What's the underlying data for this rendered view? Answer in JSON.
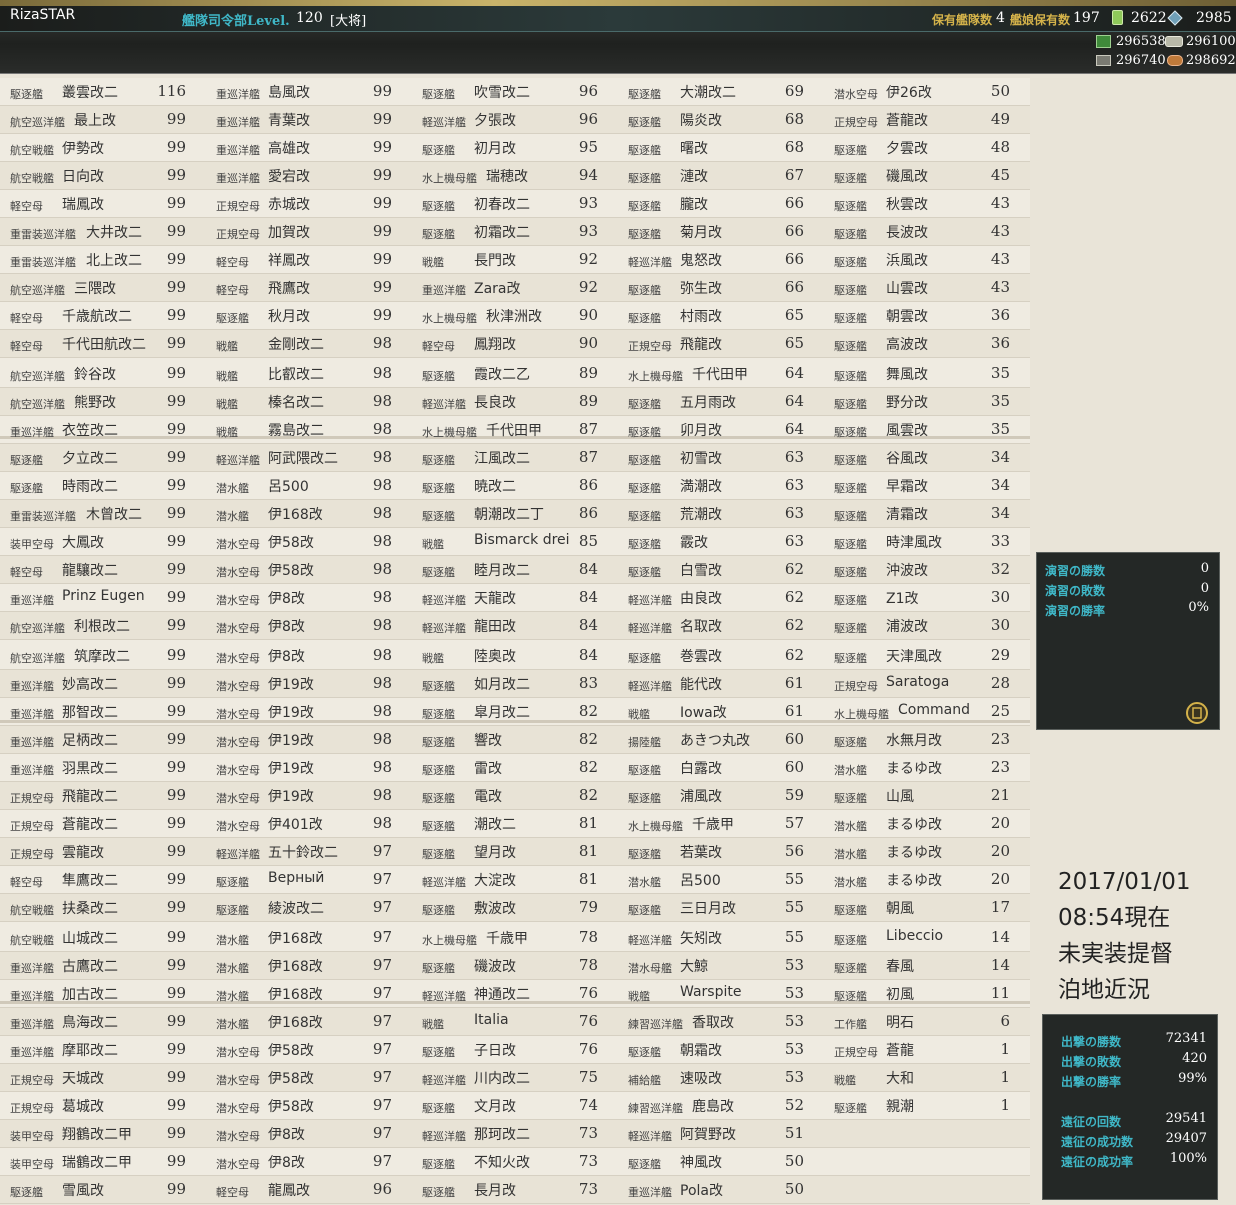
{
  "app": {
    "title": "RizaSTAR"
  },
  "header": {
    "hq_label": "艦隊司令部Level.",
    "hq_level": "120",
    "hq_rank": "[大将]",
    "fleet_label": "保有艦隊数",
    "fleet_count": "4",
    "ship_label": "艦娘保有数",
    "ship_count": "197",
    "bucket": "2622",
    "devmat": "2985",
    "fuel": "296538",
    "ammo": "296100",
    "steel": "296740",
    "bauxite": "298692"
  },
  "ships": [
    [
      "駆逐艦",
      "叢雲改二",
      "116",
      "重巡洋艦",
      "島風改",
      "99",
      "駆逐艦",
      "吹雪改二",
      "96",
      "駆逐艦",
      "大潮改二",
      "69",
      "潜水空母",
      "伊26改",
      "50"
    ],
    [
      "航空巡洋艦",
      "最上改",
      "99",
      "重巡洋艦",
      "青葉改",
      "99",
      "軽巡洋艦",
      "夕張改",
      "96",
      "駆逐艦",
      "陽炎改",
      "68",
      "正規空母",
      "蒼龍改",
      "49"
    ],
    [
      "航空戦艦",
      "伊勢改",
      "99",
      "重巡洋艦",
      "高雄改",
      "99",
      "駆逐艦",
      "初月改",
      "95",
      "駆逐艦",
      "曙改",
      "68",
      "駆逐艦",
      "夕雲改",
      "48"
    ],
    [
      "航空戦艦",
      "日向改",
      "99",
      "重巡洋艦",
      "愛宕改",
      "99",
      "水上機母艦",
      "瑞穂改",
      "94",
      "駆逐艦",
      "漣改",
      "67",
      "駆逐艦",
      "磯風改",
      "45"
    ],
    [
      "軽空母",
      "瑞鳳改",
      "99",
      "正規空母",
      "赤城改",
      "99",
      "駆逐艦",
      "初春改二",
      "93",
      "駆逐艦",
      "朧改",
      "66",
      "駆逐艦",
      "秋雲改",
      "43"
    ],
    [
      "重雷装巡洋艦",
      "大井改二",
      "99",
      "正規空母",
      "加賀改",
      "99",
      "駆逐艦",
      "初霜改二",
      "93",
      "駆逐艦",
      "菊月改",
      "66",
      "駆逐艦",
      "長波改",
      "43"
    ],
    [
      "重雷装巡洋艦",
      "北上改二",
      "99",
      "軽空母",
      "祥鳳改",
      "99",
      "戦艦",
      "長門改",
      "92",
      "軽巡洋艦",
      "鬼怒改",
      "66",
      "駆逐艦",
      "浜風改",
      "43"
    ],
    [
      "航空巡洋艦",
      "三隈改",
      "99",
      "軽空母",
      "飛鷹改",
      "99",
      "重巡洋艦",
      "Zara改",
      "92",
      "駆逐艦",
      "弥生改",
      "66",
      "駆逐艦",
      "山雲改",
      "43"
    ],
    [
      "軽空母",
      "千歳航改二",
      "99",
      "駆逐艦",
      "秋月改",
      "99",
      "水上機母艦",
      "秋津洲改",
      "90",
      "駆逐艦",
      "村雨改",
      "65",
      "駆逐艦",
      "朝雲改",
      "36"
    ],
    [
      "軽空母",
      "千代田航改二",
      "99",
      "戦艦",
      "金剛改二",
      "98",
      "軽空母",
      "鳳翔改",
      "90",
      "正規空母",
      "飛龍改",
      "65",
      "駆逐艦",
      "高波改",
      "36"
    ],
    [
      "航空巡洋艦",
      "鈴谷改",
      "99",
      "戦艦",
      "比叡改二",
      "98",
      "駆逐艦",
      "霞改二乙",
      "89",
      "水上機母艦",
      "千代田甲",
      "64",
      "駆逐艦",
      "舞風改",
      "35"
    ],
    [
      "航空巡洋艦",
      "熊野改",
      "99",
      "戦艦",
      "榛名改二",
      "98",
      "軽巡洋艦",
      "長良改",
      "89",
      "駆逐艦",
      "五月雨改",
      "64",
      "駆逐艦",
      "野分改",
      "35"
    ],
    [
      "重巡洋艦",
      "衣笠改二",
      "99",
      "戦艦",
      "霧島改二",
      "98",
      "水上機母艦",
      "千代田甲",
      "87",
      "駆逐艦",
      "卯月改",
      "64",
      "駆逐艦",
      "風雲改",
      "35"
    ],
    [
      "駆逐艦",
      "夕立改二",
      "99",
      "軽巡洋艦",
      "阿武隈改二",
      "98",
      "駆逐艦",
      "江風改二",
      "87",
      "駆逐艦",
      "初雪改",
      "63",
      "駆逐艦",
      "谷風改",
      "34"
    ],
    [
      "駆逐艦",
      "時雨改二",
      "99",
      "潜水艦",
      "呂500",
      "98",
      "駆逐艦",
      "暁改二",
      "86",
      "駆逐艦",
      "満潮改",
      "63",
      "駆逐艦",
      "早霜改",
      "34"
    ],
    [
      "重雷装巡洋艦",
      "木曾改二",
      "99",
      "潜水艦",
      "伊168改",
      "98",
      "駆逐艦",
      "朝潮改二丁",
      "86",
      "駆逐艦",
      "荒潮改",
      "63",
      "駆逐艦",
      "清霜改",
      "34"
    ],
    [
      "装甲空母",
      "大鳳改",
      "99",
      "潜水空母",
      "伊58改",
      "98",
      "戦艦",
      "Bismarck drei",
      "85",
      "駆逐艦",
      "霰改",
      "63",
      "駆逐艦",
      "時津風改",
      "33"
    ],
    [
      "軽空母",
      "龍驤改二",
      "99",
      "潜水空母",
      "伊58改",
      "98",
      "駆逐艦",
      "睦月改二",
      "84",
      "駆逐艦",
      "白雪改",
      "62",
      "駆逐艦",
      "沖波改",
      "32"
    ],
    [
      "重巡洋艦",
      "Prinz Eugen",
      "99",
      "潜水空母",
      "伊8改",
      "98",
      "軽巡洋艦",
      "天龍改",
      "84",
      "軽巡洋艦",
      "由良改",
      "62",
      "駆逐艦",
      "Z1改",
      "30"
    ],
    [
      "航空巡洋艦",
      "利根改二",
      "99",
      "潜水空母",
      "伊8改",
      "98",
      "軽巡洋艦",
      "龍田改",
      "84",
      "軽巡洋艦",
      "名取改",
      "62",
      "駆逐艦",
      "浦波改",
      "30"
    ],
    [
      "航空巡洋艦",
      "筑摩改二",
      "99",
      "潜水空母",
      "伊8改",
      "98",
      "戦艦",
      "陸奥改",
      "84",
      "駆逐艦",
      "巻雲改",
      "62",
      "駆逐艦",
      "天津風改",
      "29"
    ],
    [
      "重巡洋艦",
      "妙高改二",
      "99",
      "潜水空母",
      "伊19改",
      "98",
      "駆逐艦",
      "如月改二",
      "83",
      "軽巡洋艦",
      "能代改",
      "61",
      "正規空母",
      "Saratoga",
      "28"
    ],
    [
      "重巡洋艦",
      "那智改二",
      "99",
      "潜水空母",
      "伊19改",
      "98",
      "駆逐艦",
      "皐月改二",
      "82",
      "戦艦",
      "Iowa改",
      "61",
      "水上機母艦",
      "Command",
      "25"
    ],
    [
      "重巡洋艦",
      "足柄改二",
      "99",
      "潜水空母",
      "伊19改",
      "98",
      "駆逐艦",
      "響改",
      "82",
      "揚陸艦",
      "あきつ丸改",
      "60",
      "駆逐艦",
      "水無月改",
      "23"
    ],
    [
      "重巡洋艦",
      "羽黒改二",
      "99",
      "潜水空母",
      "伊19改",
      "98",
      "駆逐艦",
      "雷改",
      "82",
      "駆逐艦",
      "白露改",
      "60",
      "潜水艦",
      "まるゆ改",
      "23"
    ],
    [
      "正規空母",
      "飛龍改二",
      "99",
      "潜水空母",
      "伊19改",
      "98",
      "駆逐艦",
      "電改",
      "82",
      "駆逐艦",
      "浦風改",
      "59",
      "駆逐艦",
      "山風",
      "21"
    ],
    [
      "正規空母",
      "蒼龍改二",
      "99",
      "潜水空母",
      "伊401改",
      "98",
      "駆逐艦",
      "潮改二",
      "81",
      "水上機母艦",
      "千歳甲",
      "57",
      "潜水艦",
      "まるゆ改",
      "20"
    ],
    [
      "正規空母",
      "雲龍改",
      "99",
      "軽巡洋艦",
      "五十鈴改二",
      "97",
      "駆逐艦",
      "望月改",
      "81",
      "駆逐艦",
      "若葉改",
      "56",
      "潜水艦",
      "まるゆ改",
      "20"
    ],
    [
      "軽空母",
      "隼鷹改二",
      "99",
      "駆逐艦",
      "Верный",
      "97",
      "軽巡洋艦",
      "大淀改",
      "81",
      "潜水艦",
      "呂500",
      "55",
      "潜水艦",
      "まるゆ改",
      "20"
    ],
    [
      "航空戦艦",
      "扶桑改二",
      "99",
      "駆逐艦",
      "綾波改二",
      "97",
      "駆逐艦",
      "敷波改",
      "79",
      "駆逐艦",
      "三日月改",
      "55",
      "駆逐艦",
      "朝風",
      "17"
    ],
    [
      "航空戦艦",
      "山城改二",
      "99",
      "潜水艦",
      "伊168改",
      "97",
      "水上機母艦",
      "千歳甲",
      "78",
      "軽巡洋艦",
      "矢矧改",
      "55",
      "駆逐艦",
      "Libeccio",
      "14"
    ],
    [
      "重巡洋艦",
      "古鷹改二",
      "99",
      "潜水艦",
      "伊168改",
      "97",
      "駆逐艦",
      "磯波改",
      "78",
      "潜水母艦",
      "大鯨",
      "53",
      "駆逐艦",
      "春風",
      "14"
    ],
    [
      "重巡洋艦",
      "加古改二",
      "99",
      "潜水艦",
      "伊168改",
      "97",
      "軽巡洋艦",
      "神通改二",
      "76",
      "戦艦",
      "Warspite",
      "53",
      "駆逐艦",
      "初風",
      "11"
    ],
    [
      "重巡洋艦",
      "鳥海改二",
      "99",
      "潜水艦",
      "伊168改",
      "97",
      "戦艦",
      "Italia",
      "76",
      "練習巡洋艦",
      "香取改",
      "53",
      "工作艦",
      "明石",
      "6"
    ],
    [
      "重巡洋艦",
      "摩耶改二",
      "99",
      "潜水空母",
      "伊58改",
      "97",
      "駆逐艦",
      "子日改",
      "76",
      "駆逐艦",
      "朝霜改",
      "53",
      "正規空母",
      "蒼龍",
      "1"
    ],
    [
      "正規空母",
      "天城改",
      "99",
      "潜水空母",
      "伊58改",
      "97",
      "軽巡洋艦",
      "川内改二",
      "75",
      "補給艦",
      "速吸改",
      "53",
      "戦艦",
      "大和",
      "1"
    ],
    [
      "正規空母",
      "葛城改",
      "99",
      "潜水空母",
      "伊58改",
      "97",
      "駆逐艦",
      "文月改",
      "74",
      "練習巡洋艦",
      "鹿島改",
      "52",
      "駆逐艦",
      "親潮",
      "1"
    ],
    [
      "装甲空母",
      "翔鶴改二甲",
      "99",
      "潜水空母",
      "伊8改",
      "97",
      "軽巡洋艦",
      "那珂改二",
      "73",
      "軽巡洋艦",
      "阿賀野改",
      "51",
      "",
      "",
      ""
    ],
    [
      "装甲空母",
      "瑞鶴改二甲",
      "99",
      "潜水空母",
      "伊8改",
      "97",
      "駆逐艦",
      "不知火改",
      "73",
      "駆逐艦",
      "神風改",
      "50",
      "",
      "",
      ""
    ],
    [
      "駆逐艦",
      "雪風改",
      "99",
      "軽空母",
      "龍鳳改",
      "96",
      "駆逐艦",
      "長月改",
      "73",
      "重巡洋艦",
      "Pola改",
      "50",
      "",
      "",
      ""
    ]
  ],
  "exercise": {
    "wins_label": "演習の勝数",
    "wins": "0",
    "losses_label": "演習の敗数",
    "losses": "0",
    "rate_label": "演習の勝率",
    "rate": "0%"
  },
  "date_text": [
    "2017/01/01",
    "08:54現在",
    "未実装提督",
    "泊地近況"
  ],
  "sortie": {
    "wins_label": "出撃の勝数",
    "wins": "72341",
    "losses_label": "出撃の敗数",
    "losses": "420",
    "rate_label": "出撃の勝率",
    "rate": "99%",
    "exp_count_label": "遠征の回数",
    "exp_count": "29541",
    "exp_success_label": "遠征の成功数",
    "exp_success": "29407",
    "exp_rate_label": "遠征の成功率",
    "exp_rate": "100%"
  },
  "colors": {
    "accent": "#3fb7c7",
    "gold": "#d4b24a"
  }
}
